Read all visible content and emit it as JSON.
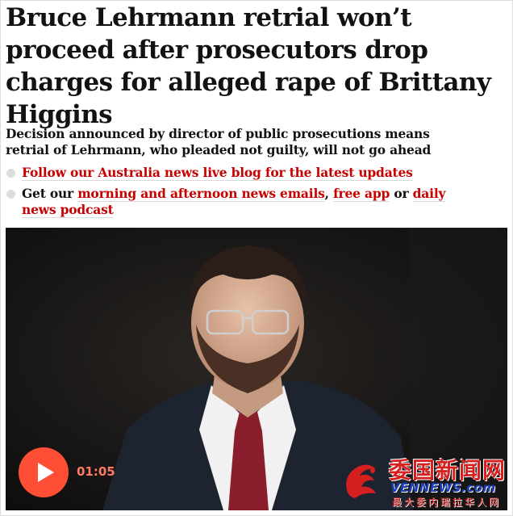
{
  "article": {
    "headline": "Bruce Lehrmann retrial won’t proceed after prosecutors drop charges for alleged rape of Brittany Higgins",
    "standfirst": "Decision announced by director of public prosecutions means retrial of Lehrmann, who pleaded not guilty, will not go ahead",
    "bullet1": {
      "link": "Follow our Australia news live blog for the latest updates"
    },
    "bullet2": {
      "prefix": "Get our ",
      "link1": "morning and afternoon news emails",
      "sep1": ", ",
      "link2": "free app",
      "sep2": " or ",
      "link3": "daily news podcast"
    }
  },
  "video": {
    "duration": "01:05",
    "play_icon": "play-icon"
  },
  "watermark": {
    "title": "委国新闻网",
    "subtitle": "VENNEWS.com",
    "tagline": "最大委内瑞拉华人网"
  },
  "colors": {
    "link": "#c70000",
    "play": "#ff4e36",
    "duration": "#ff7a63"
  }
}
